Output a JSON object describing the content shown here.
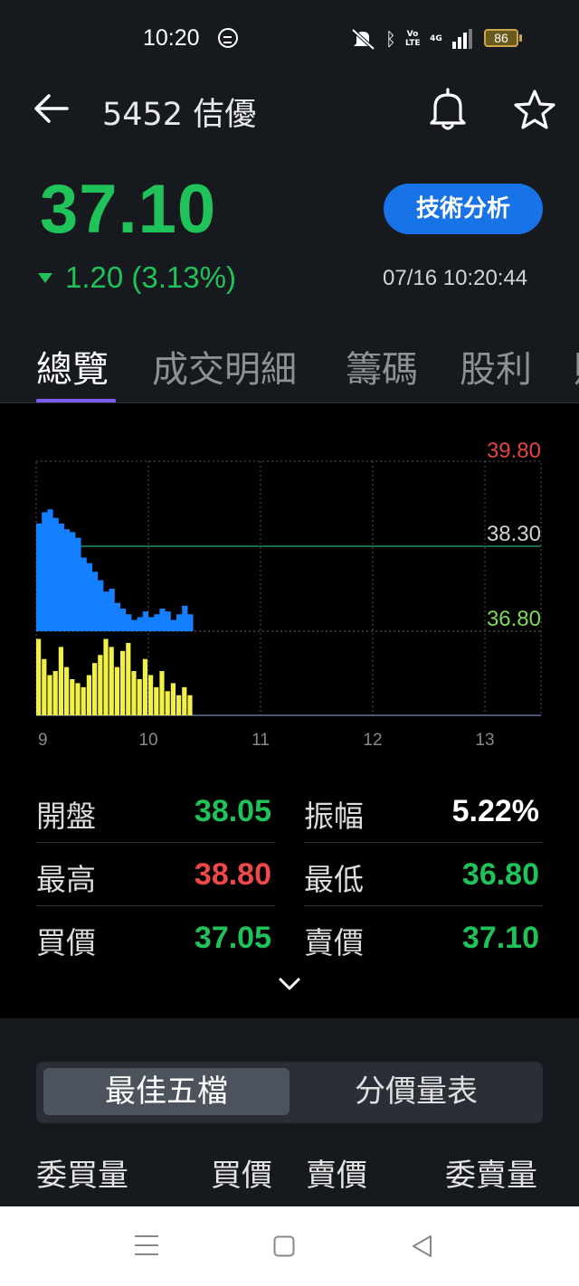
{
  "status_bar": {
    "time": "10:20",
    "battery": "86",
    "network": "4G",
    "volte": "Vo LTE"
  },
  "header": {
    "title": "5452 佶優"
  },
  "quote": {
    "price": "37.10",
    "change": "1.20 (3.13%)",
    "direction": "down",
    "timestamp": "07/16 10:20:44",
    "tech_button": "技術分析",
    "colors": {
      "down": "#20c25a",
      "up": "#f04848",
      "accent": "#1773e6",
      "tab_indicator": "#7d5cf2"
    }
  },
  "tabs": [
    {
      "label": "總覽",
      "active": true
    },
    {
      "label": "成交明細",
      "active": false
    },
    {
      "label": "籌碼",
      "active": false
    },
    {
      "label": "股利",
      "active": false
    },
    {
      "label": "財",
      "active": false
    }
  ],
  "chart_data": {
    "type": "area",
    "price_axis": {
      "high": "39.80",
      "ref": "38.30",
      "low": "36.80",
      "ylim": [
        36.8,
        39.8
      ]
    },
    "x_ticks": [
      "9",
      "10",
      "11",
      "12",
      "13"
    ],
    "xlim": [
      9,
      13.5
    ],
    "grid": true,
    "price_series": {
      "color": "#1580ff",
      "x": [
        9.0,
        9.05,
        9.1,
        9.15,
        9.2,
        9.25,
        9.3,
        9.35,
        9.4,
        9.45,
        9.5,
        9.55,
        9.6,
        9.65,
        9.7,
        9.75,
        9.8,
        9.85,
        9.9,
        9.95,
        10.0,
        10.05,
        10.1,
        10.15,
        10.2,
        10.25,
        10.3,
        10.35
      ],
      "y": [
        38.7,
        38.9,
        38.95,
        38.8,
        38.7,
        38.6,
        38.55,
        38.45,
        38.1,
        38.0,
        37.85,
        37.7,
        37.5,
        37.55,
        37.3,
        37.2,
        37.1,
        37.0,
        37.05,
        37.15,
        37.05,
        37.1,
        37.2,
        37.15,
        37.0,
        37.1,
        37.25,
        37.1
      ]
    },
    "volume_series": {
      "color": "#f0f046",
      "x": [
        9.0,
        9.05,
        9.1,
        9.15,
        9.2,
        9.25,
        9.3,
        9.35,
        9.4,
        9.45,
        9.5,
        9.55,
        9.6,
        9.65,
        9.7,
        9.75,
        9.8,
        9.85,
        9.9,
        9.95,
        10.0,
        10.05,
        10.1,
        10.15,
        10.2,
        10.25,
        10.3,
        10.35
      ],
      "values": [
        0.95,
        0.7,
        0.5,
        0.55,
        0.85,
        0.6,
        0.45,
        0.4,
        0.35,
        0.5,
        0.65,
        0.75,
        0.95,
        0.85,
        0.6,
        0.8,
        0.9,
        0.55,
        0.45,
        0.7,
        0.5,
        0.35,
        0.55,
        0.3,
        0.4,
        0.25,
        0.35,
        0.25
      ]
    }
  },
  "stats": [
    {
      "label": "開盤",
      "value": "38.05",
      "color": "#20c25a"
    },
    {
      "label": "振幅",
      "value": "5.22%",
      "color": "#ffffff"
    },
    {
      "label": "最高",
      "value": "38.80",
      "color": "#f04848"
    },
    {
      "label": "最低",
      "value": "36.80",
      "color": "#20c25a"
    },
    {
      "label": "買價",
      "value": "37.05",
      "color": "#20c25a"
    },
    {
      "label": "賣價",
      "value": "37.10",
      "color": "#20c25a"
    }
  ],
  "order_book": {
    "segments": [
      "最佳五檔",
      "分價量表"
    ],
    "headers": [
      "委買量",
      "買價",
      "賣價",
      "委賣量"
    ]
  }
}
